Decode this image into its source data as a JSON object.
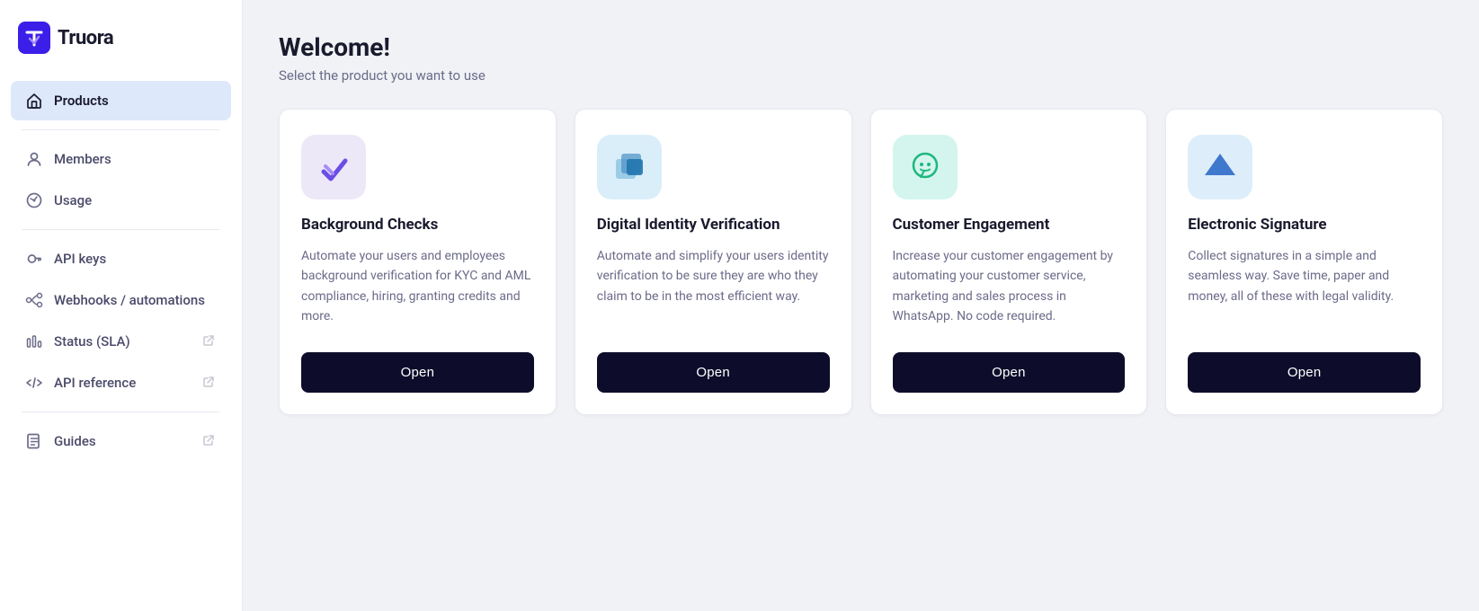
{
  "app": {
    "logo_text": "Truora"
  },
  "sidebar": {
    "items": [
      {
        "id": "products",
        "label": "Products",
        "active": true,
        "external": false
      },
      {
        "id": "members",
        "label": "Members",
        "active": false,
        "external": false
      },
      {
        "id": "usage",
        "label": "Usage",
        "active": false,
        "external": false
      },
      {
        "id": "api-keys",
        "label": "API keys",
        "active": false,
        "external": false
      },
      {
        "id": "webhooks",
        "label": "Webhooks / automations",
        "active": false,
        "external": false
      },
      {
        "id": "status",
        "label": "Status (SLA)",
        "active": false,
        "external": true
      },
      {
        "id": "api-ref",
        "label": "API reference",
        "active": false,
        "external": true
      },
      {
        "id": "guides",
        "label": "Guides",
        "active": false,
        "external": true
      }
    ]
  },
  "main": {
    "title": "Welcome!",
    "subtitle": "Select the product you want to use",
    "products": [
      {
        "id": "background-checks",
        "name": "Background Checks",
        "description": "Automate your users and employees background verification for KYC and AML compliance, hiring, granting credits and more.",
        "open_label": "Open",
        "icon_bg": "bg-purple"
      },
      {
        "id": "digital-identity",
        "name": "Digital Identity Verification",
        "description": "Automate and simplify your users identity verification to be sure they are who they claim to be in the most efficient way.",
        "open_label": "Open",
        "icon_bg": "bg-blue"
      },
      {
        "id": "customer-engagement",
        "name": "Customer Engagement",
        "description": "Increase your customer engagement by automating your customer service, marketing and sales process in WhatsApp. No code required.",
        "open_label": "Open",
        "icon_bg": "bg-teal"
      },
      {
        "id": "electronic-signature",
        "name": "Electronic Signature",
        "description": "Collect signatures in a simple and seamless way. Save time, paper and money, all of these with legal validity.",
        "open_label": "Open",
        "icon_bg": "bg-lightblue"
      }
    ]
  }
}
